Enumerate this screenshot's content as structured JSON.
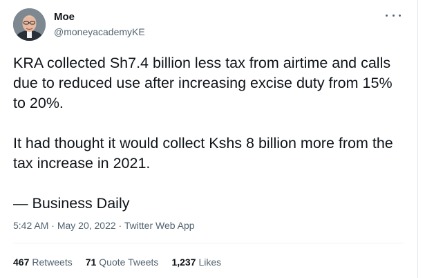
{
  "author": {
    "name": "Moe",
    "handle": "@moneyacademyKE"
  },
  "tweet": {
    "paragraphs": [
      "KRA collected Sh7.4 billion less tax from airtime and calls due to reduced use after increasing excise duty from 15% to 20%.",
      "It had thought it would collect Kshs 8 billion more from the tax increase in 2021.",
      "— Business Daily"
    ]
  },
  "meta": {
    "time": "5:42 AM",
    "date": "May 20, 2022",
    "source": "Twitter Web App",
    "separator": " · "
  },
  "stats": {
    "retweets_count": "467",
    "retweets_label": "Retweets",
    "quotes_count": "71",
    "quotes_label": "Quote Tweets",
    "likes_count": "1,237",
    "likes_label": "Likes"
  },
  "icons": {
    "more": "more-icon",
    "avatar": "avatar"
  },
  "colors": {
    "text": "#0f1419",
    "secondary": "#536471",
    "divider": "#eff3f4"
  }
}
